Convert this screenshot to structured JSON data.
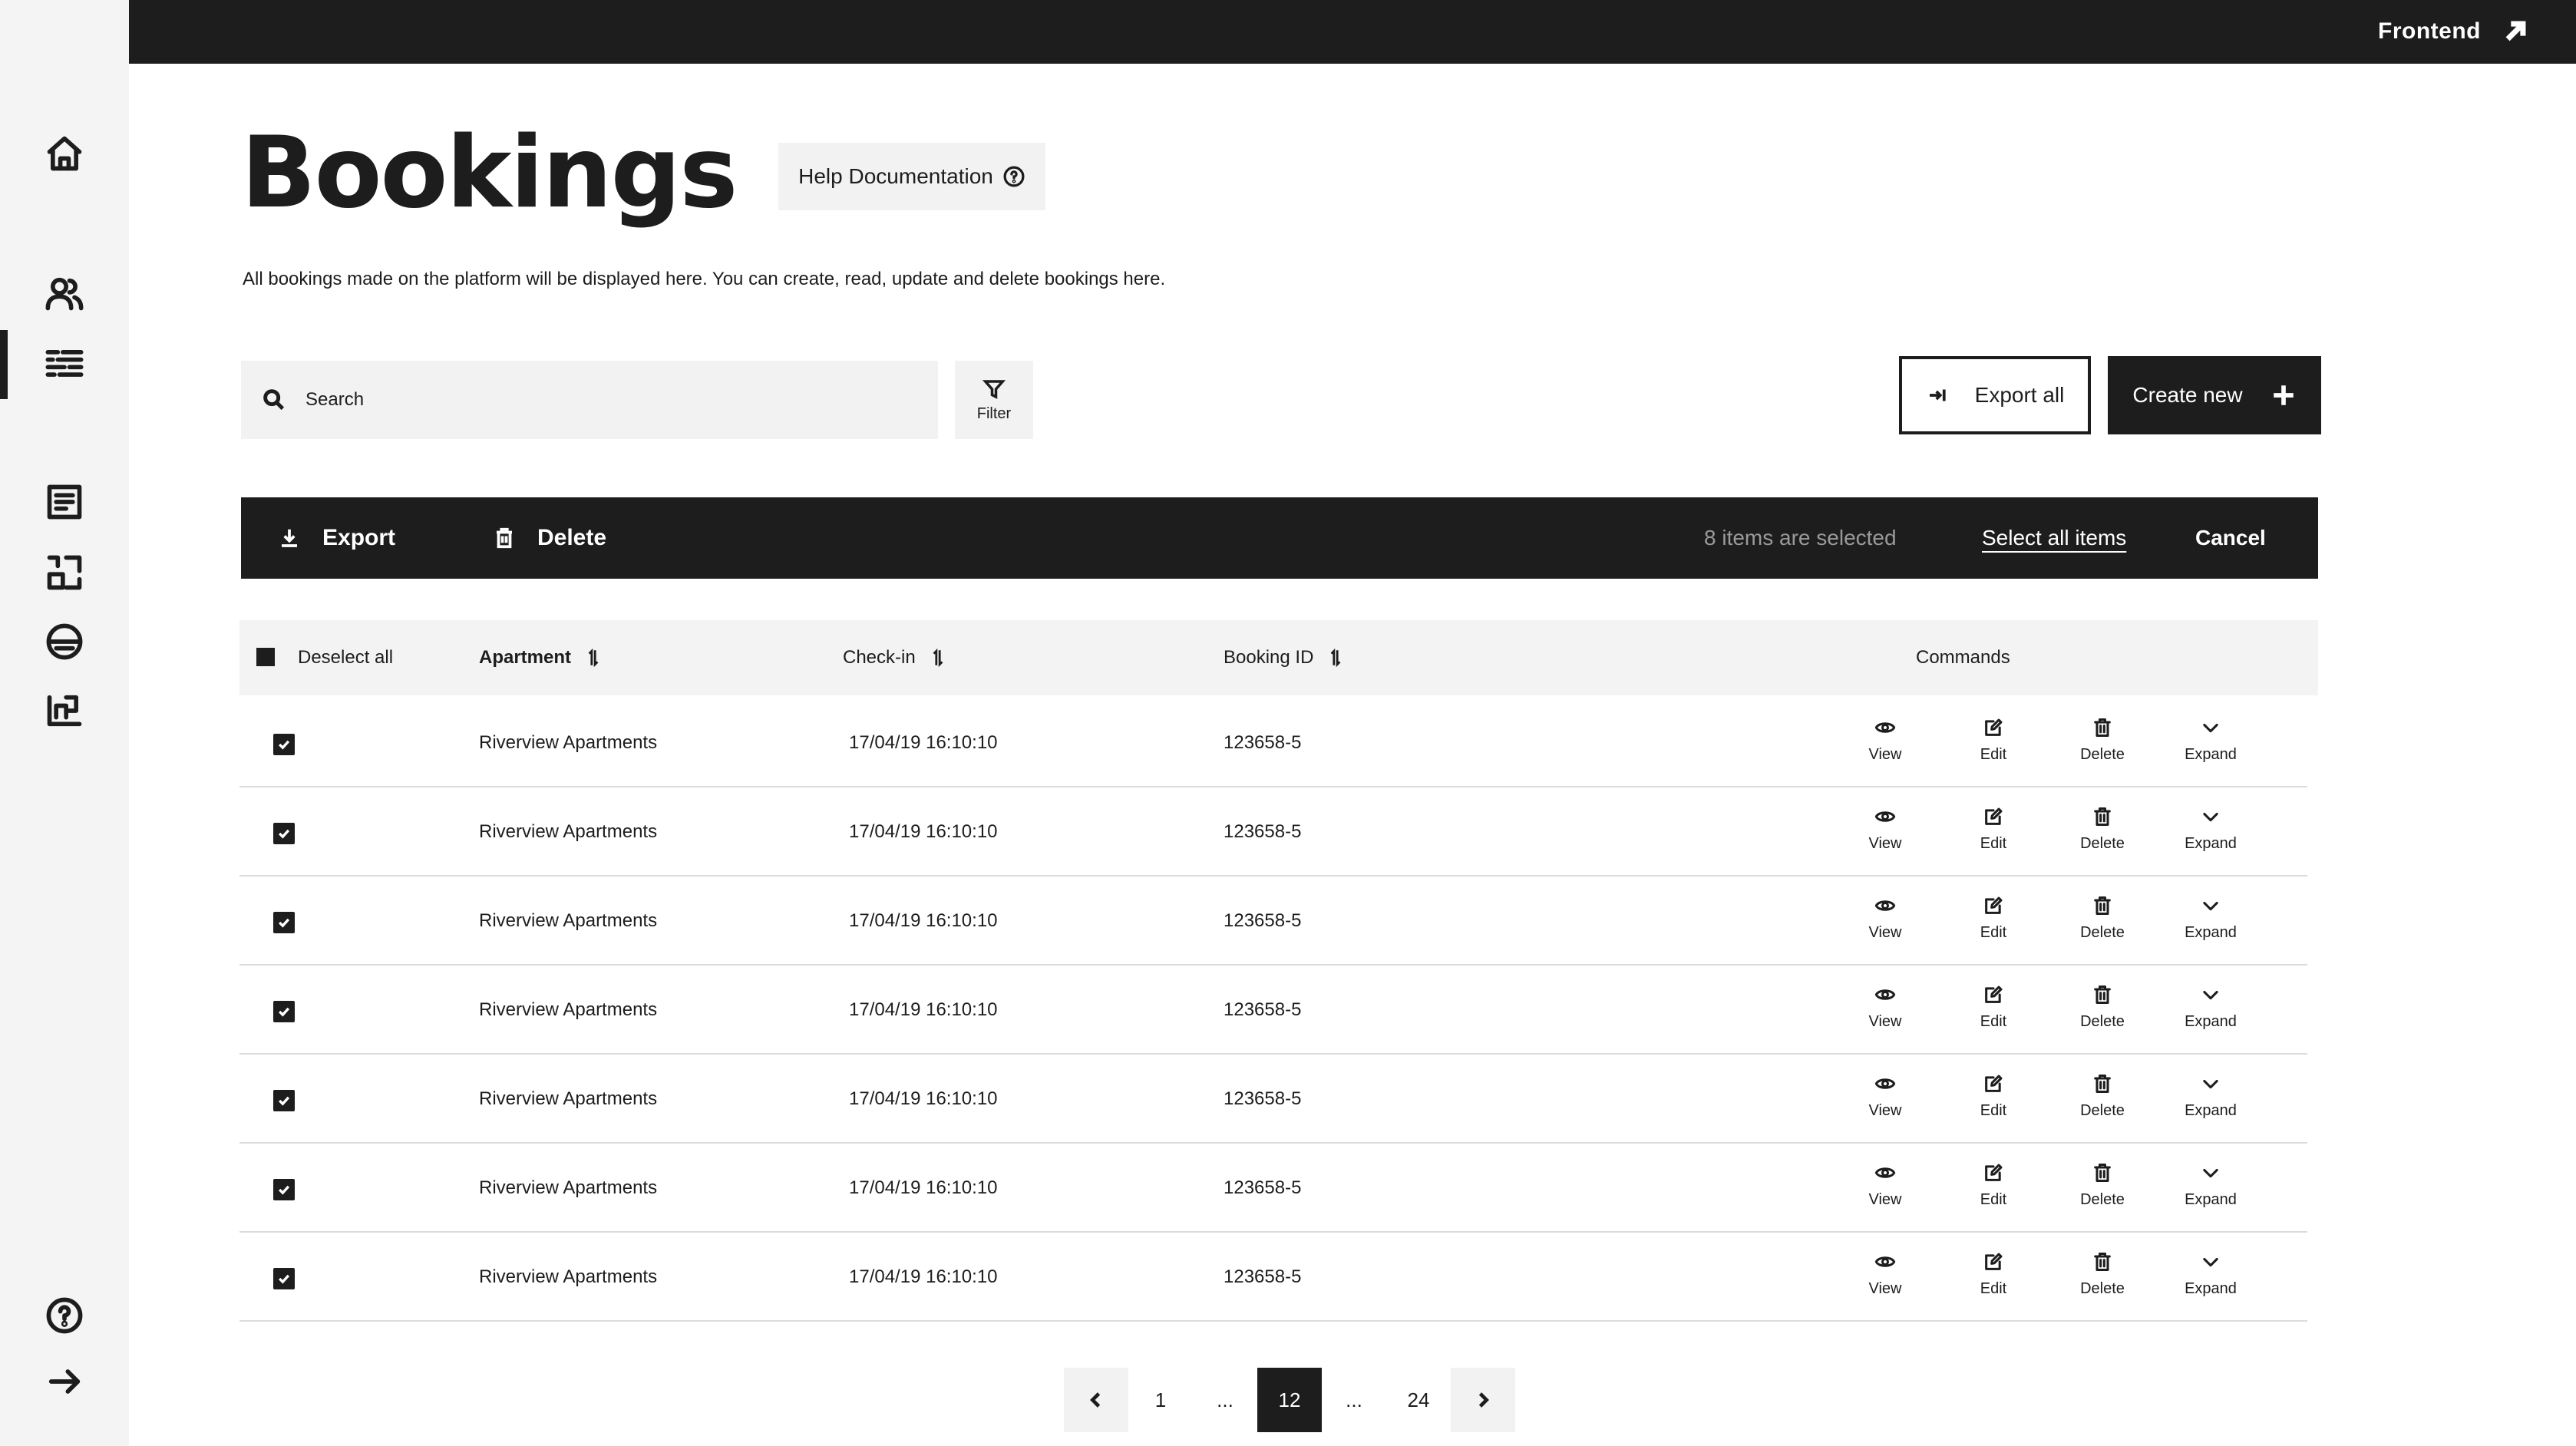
{
  "topbar": {
    "frontend_label": "Frontend"
  },
  "sidebar": {
    "items": [
      {
        "name": "home-icon"
      },
      {
        "name": "users-icon"
      },
      {
        "name": "bookings-list-icon",
        "active": true
      },
      {
        "name": "document-icon"
      },
      {
        "name": "dashboard-icon"
      },
      {
        "name": "compass-icon"
      },
      {
        "name": "chart-icon"
      },
      {
        "name": "help-icon"
      },
      {
        "name": "arrow-right-icon"
      }
    ]
  },
  "header": {
    "title": "Bookings",
    "help_label": "Help Documentation",
    "description": "All bookings made on the platform will be displayed here. You can create, read, update and delete bookings here."
  },
  "toolbar": {
    "search_placeholder": "Search",
    "filter_label": "Filter",
    "export_all_label": "Export all",
    "create_new_label": "Create new"
  },
  "selection_bar": {
    "export_label": "Export",
    "delete_label": "Delete",
    "count_text": "8 items are selected",
    "select_all_label": "Select all items",
    "cancel_label": "Cancel"
  },
  "table": {
    "deselect_label": "Deselect all",
    "columns": {
      "apartment": "Apartment",
      "checkin": "Check-in",
      "booking_id": "Booking ID",
      "commands": "Commands"
    },
    "commands": {
      "view": "View",
      "edit": "Edit",
      "delete": "Delete",
      "expand": "Expand"
    },
    "rows": [
      {
        "apartment": "Riverview Apartments",
        "checkin": "17/04/19 16:10:10",
        "booking_id": "123658-5",
        "checked": true
      },
      {
        "apartment": "Riverview Apartments",
        "checkin": "17/04/19 16:10:10",
        "booking_id": "123658-5",
        "checked": true
      },
      {
        "apartment": "Riverview Apartments",
        "checkin": "17/04/19 16:10:10",
        "booking_id": "123658-5",
        "checked": true
      },
      {
        "apartment": "Riverview Apartments",
        "checkin": "17/04/19 16:10:10",
        "booking_id": "123658-5",
        "checked": true
      },
      {
        "apartment": "Riverview Apartments",
        "checkin": "17/04/19 16:10:10",
        "booking_id": "123658-5",
        "checked": true
      },
      {
        "apartment": "Riverview Apartments",
        "checkin": "17/04/19 16:10:10",
        "booking_id": "123658-5",
        "checked": true
      },
      {
        "apartment": "Riverview Apartments",
        "checkin": "17/04/19 16:10:10",
        "booking_id": "123658-5",
        "checked": true
      }
    ]
  },
  "pagination": {
    "first": "1",
    "ellipsis": "...",
    "current": "12",
    "last": "24"
  },
  "colors": {
    "dark": "#1d1d1d",
    "light_bg": "#f2f2f2",
    "muted": "#9a9a9a"
  }
}
